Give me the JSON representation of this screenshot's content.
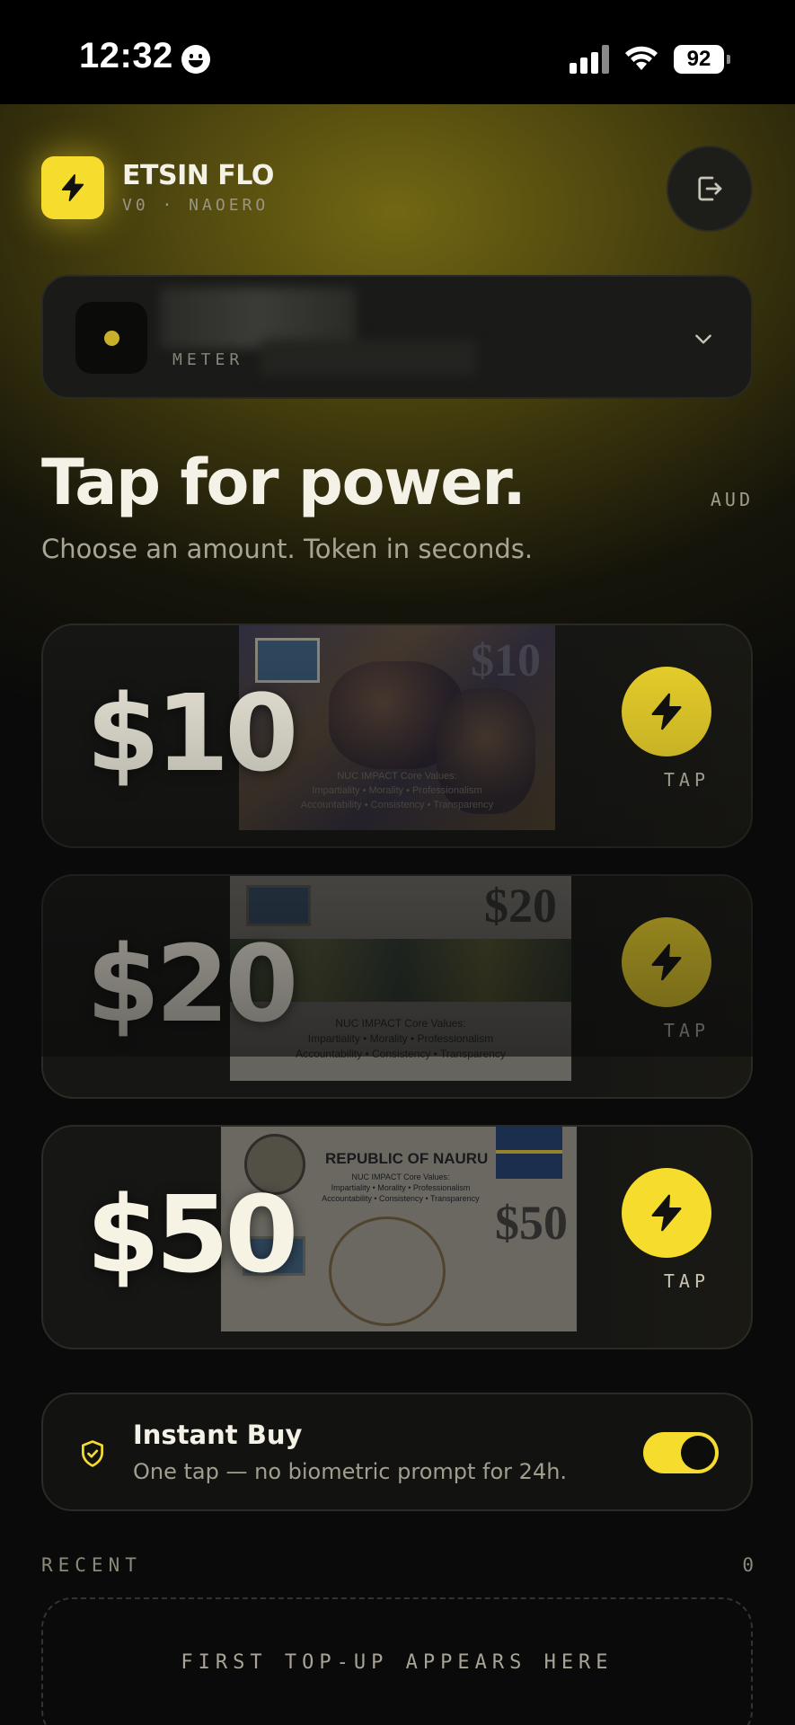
{
  "status_bar": {
    "time": "12:32",
    "battery": "92"
  },
  "brand": {
    "name": "ETSIN FLO",
    "subtitle": "V0 · NAOERO"
  },
  "meter": {
    "label": "METER"
  },
  "hero": {
    "title": "Tap for power.",
    "subtitle": "Choose an amount. Token in seconds.",
    "currency": "AUD"
  },
  "amounts": [
    {
      "value": "$10",
      "tap_label": "TAP",
      "note_value": "$10",
      "note_caption": [
        "NUC IMPACT Core Values:",
        "Impartiality • Morality • Professionalism",
        "Accountability • Consistency • Transparency"
      ]
    },
    {
      "value": "$20",
      "tap_label": "TAP",
      "note_value": "$20",
      "note_caption": [
        "NUC IMPACT Core Values:",
        "Impartiality • Morality • Professionalism",
        "Accountability • Consistency • Transparency"
      ]
    },
    {
      "value": "$50",
      "tap_label": "TAP",
      "note_value": "$50",
      "note_title": "REPUBLIC OF NAURU",
      "note_caption": [
        "NUC IMPACT Core Values:",
        "Impartiality • Morality • Professionalism",
        "Accountability • Consistency • Transparency"
      ]
    }
  ],
  "instant_buy": {
    "title": "Instant Buy",
    "subtitle": "One tap — no biometric prompt for 24h.",
    "enabled": true
  },
  "recent": {
    "label": "RECENT",
    "count": "0",
    "empty_text": "FIRST TOP-UP APPEARS HERE"
  },
  "colors": {
    "accent": "#f6dc2c",
    "background": "#0a0a0a",
    "card": "#161614"
  }
}
